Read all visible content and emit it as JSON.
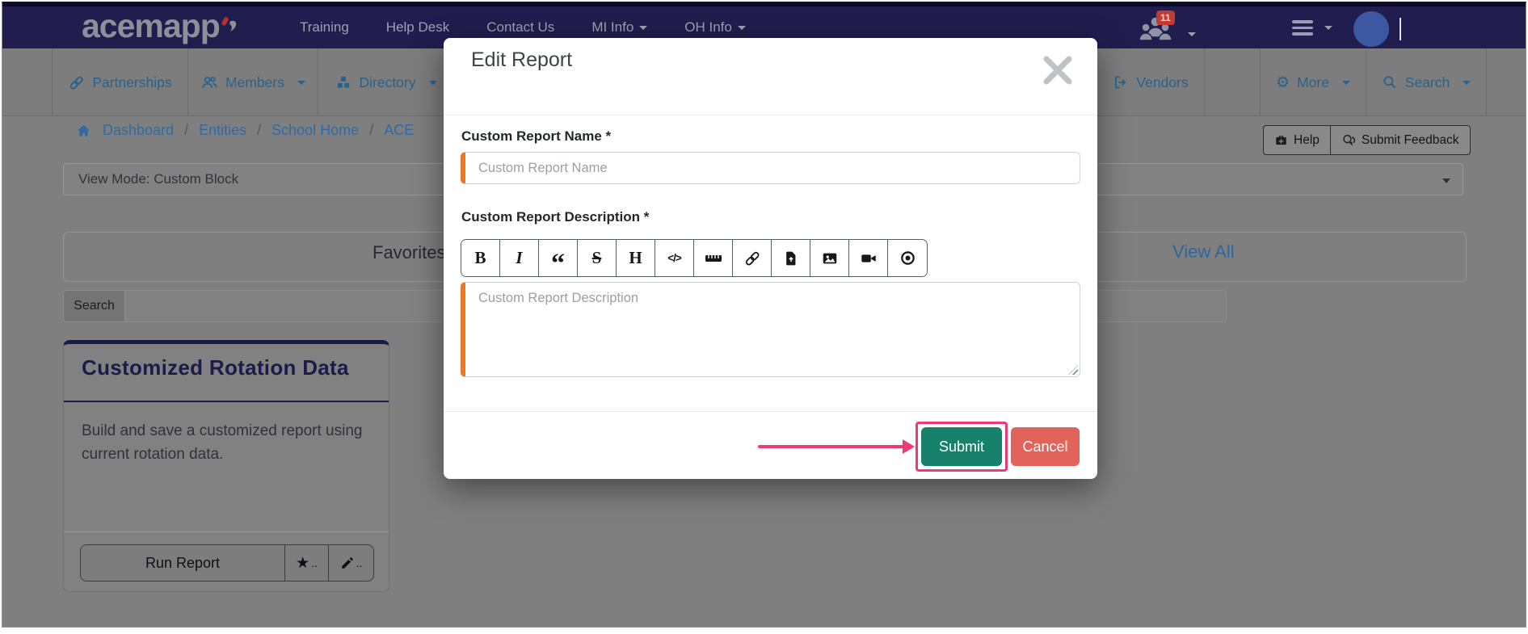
{
  "brand": {
    "name": "acemapp"
  },
  "topnav": {
    "links": [
      {
        "label": "Training"
      },
      {
        "label": "Help Desk"
      },
      {
        "label": "Contact Us"
      },
      {
        "label": "MI Info"
      },
      {
        "label": "OH Info"
      }
    ],
    "notification_count": "11"
  },
  "subnav": {
    "partnerships": "Partnerships",
    "members": "Members",
    "directory": "Directory",
    "vendors": "Vendors",
    "more": "More",
    "search": "Search"
  },
  "breadcrumb": {
    "items": [
      "Dashboard",
      "Entities",
      "School Home",
      "ACE"
    ],
    "separator": "/"
  },
  "page_actions": {
    "help_label": "Help",
    "feedback_label": "Submit Feedback"
  },
  "view_mode": {
    "value": "View Mode: Custom Block"
  },
  "favorites": {
    "title": "Favorites",
    "view_all_label": "View All"
  },
  "search": {
    "label": "Search"
  },
  "report_card": {
    "title": "Customized Rotation Data",
    "description": "Build and save a customized report using current rotation data.",
    "run_label": "Run Report",
    "star_suffix": "..",
    "edit_suffix": ".."
  },
  "modal": {
    "title": "Edit Report",
    "name_label": "Custom Report Name *",
    "name_placeholder": "Custom Report Name",
    "description_label": "Custom Report Description *",
    "description_placeholder": "Custom Report Description",
    "toolbar_icons": [
      "bold",
      "italic",
      "blockquote",
      "strikethrough",
      "heading",
      "code",
      "horizontal-rule",
      "link",
      "file",
      "image",
      "video",
      "preview"
    ],
    "toolbar": [
      {
        "glyph": "B"
      },
      {
        "glyph": "I"
      },
      {
        "glyph": "“"
      },
      {
        "glyph": "S"
      },
      {
        "glyph": "H"
      },
      {
        "glyph": "</>"
      }
    ],
    "submit_label": "Submit",
    "cancel_label": "Cancel"
  },
  "icons": {
    "star": "★",
    "gear": "⚙"
  },
  "colors": {
    "navbar": "#211d4e",
    "accent_orange": "#ee7722",
    "submit_teal": "#17816c",
    "cancel_red": "#e2635a",
    "annotation_pink": "#ee3a74",
    "link_blue": "#2e6ba6",
    "badge_red": "#c23a30"
  }
}
